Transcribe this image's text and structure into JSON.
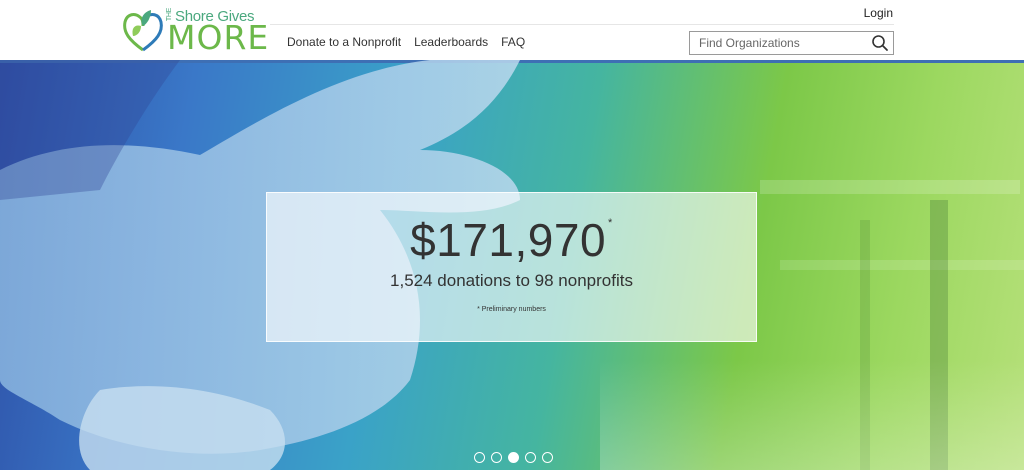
{
  "header": {
    "logo_tagline": "Shore Gives",
    "logo_tagline_prefix": "THE",
    "logo_main": "MORE",
    "login_label": "Login",
    "nav": [
      {
        "label": "Donate to a Nonprofit"
      },
      {
        "label": "Leaderboards"
      },
      {
        "label": "FAQ"
      }
    ],
    "search": {
      "placeholder": "Find Organizations",
      "value": ""
    }
  },
  "hero": {
    "amount": "$171,970",
    "amount_marker": "*",
    "summary": "1,524 donations to 98 nonprofits",
    "note": "* Preliminary numbers",
    "slides": 5,
    "active_slide": 3
  },
  "colors": {
    "brand_green": "#6cb84a",
    "brand_teal": "#4aa87e",
    "brand_blue": "#2e7bb8"
  }
}
